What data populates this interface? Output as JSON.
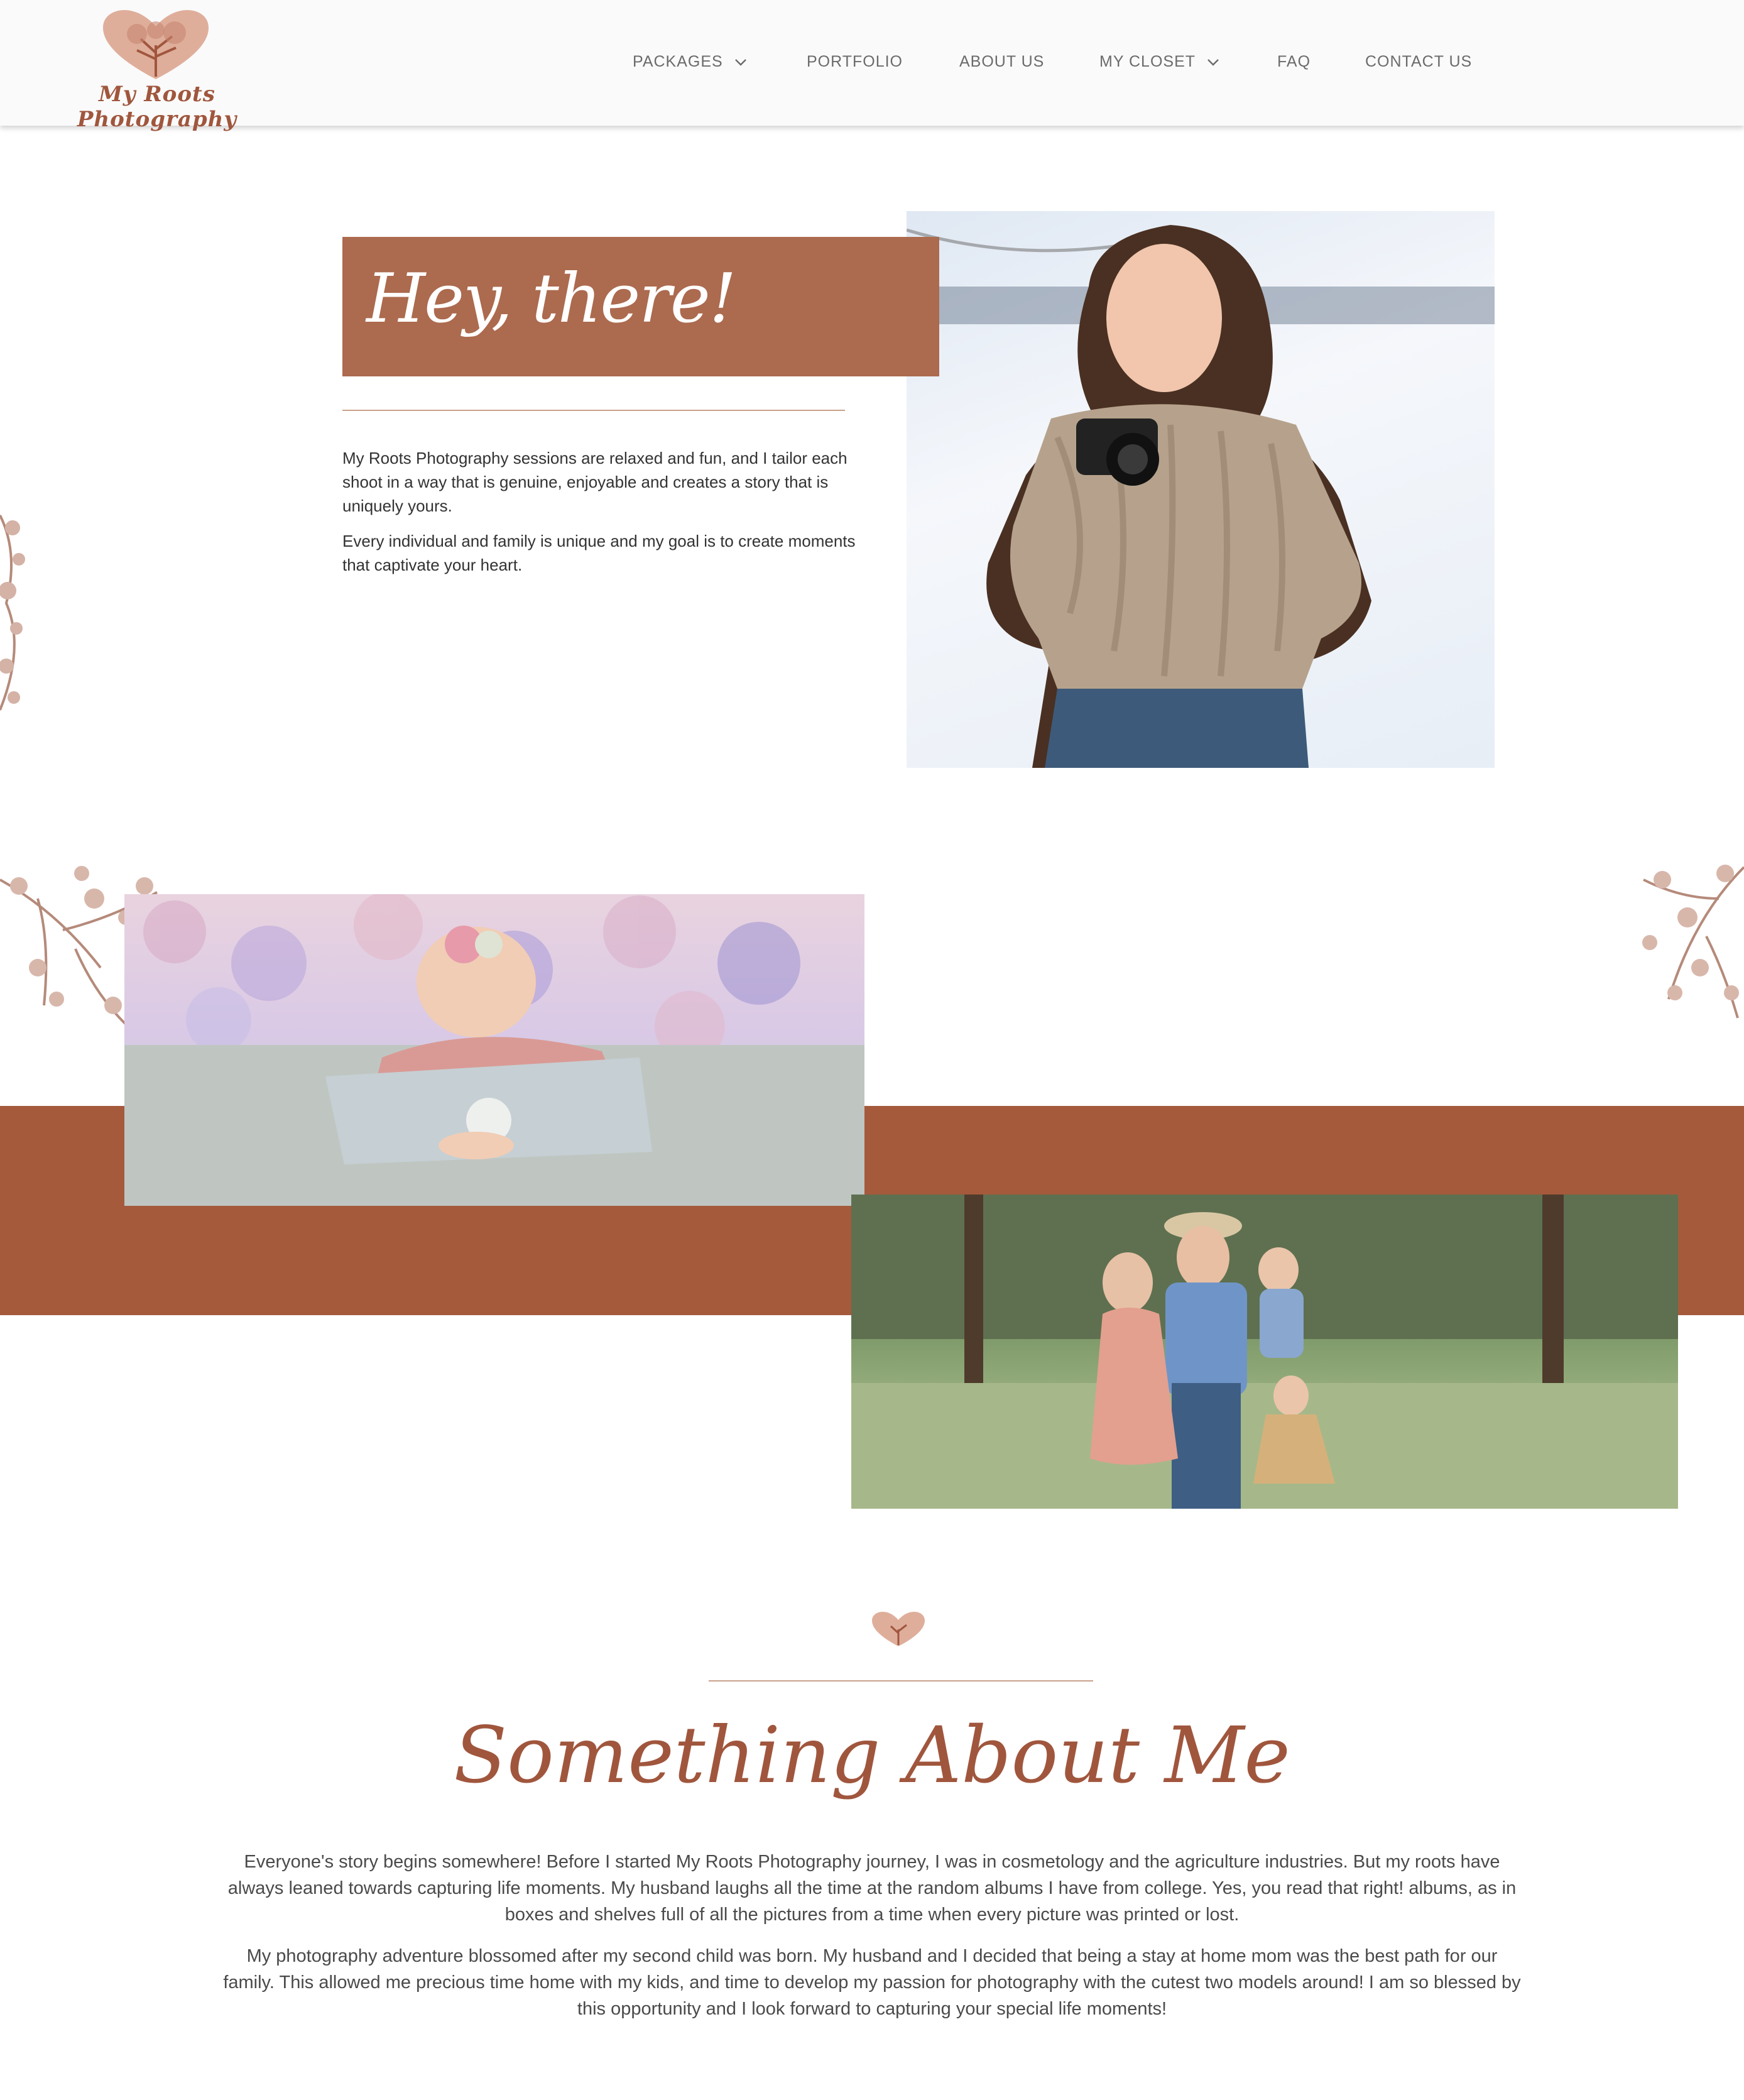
{
  "header": {
    "logo_text": "My Roots Photography",
    "nav": [
      {
        "label": "PACKAGES",
        "has_dropdown": true
      },
      {
        "label": "PORTFOLIO",
        "has_dropdown": false
      },
      {
        "label": "ABOUT US",
        "has_dropdown": false
      },
      {
        "label": "MY CLOSET",
        "has_dropdown": true
      },
      {
        "label": "FAQ",
        "has_dropdown": false
      },
      {
        "label": "CONTACT US",
        "has_dropdown": false
      }
    ]
  },
  "intro": {
    "title": "Hey, there!",
    "paragraphs": [
      "My Roots Photography sessions are relaxed and fun, and I tailor each shoot in a way that is genuine, enjoyable and creates a story that is uniquely yours.",
      "Every individual and family is unique and my goal is to create moments that captivate your heart."
    ]
  },
  "about": {
    "title": "Something About Me",
    "paragraphs": [
      "Everyone's story begins somewhere! Before I started My Roots Photography journey, I was in cosmetology and the agriculture industries. But my roots have always leaned towards capturing life moments. My husband laughs all the time at the random albums I have from college. Yes, you read that right! albums, as in boxes and shelves full of all the pictures from a time when every picture was printed or lost.",
      "My photography adventure blossomed after my second child was born. My husband and I decided that being a stay at home mom was the best path for our family. This allowed me precious time home with my kids, and time to develop my passion for photography with the cutest two models around! I am so blessed by this opportunity and I look forward to capturing your special life moments!"
    ]
  },
  "colors": {
    "accent": "#a55a3c",
    "accent_light": "#ac6a4e",
    "rule": "#c9a18a"
  }
}
